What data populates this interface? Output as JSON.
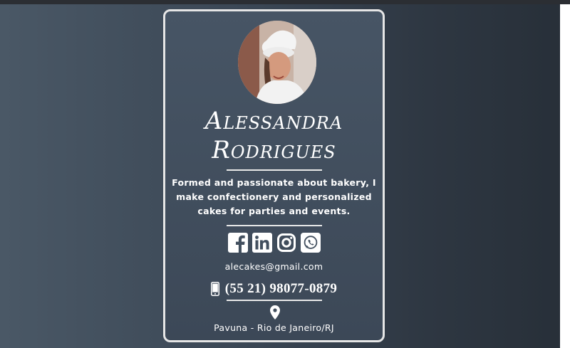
{
  "profile": {
    "name_line1": "Alessandra",
    "name_line2": "Rodrigues",
    "bio": "Formed and passionate about bakery, I make confectionery and personalized cakes for parties and events.",
    "email": "alecakes@gmail.com",
    "phone": "(55 21) 98077-0879",
    "location": "Pavuna - Rio de Janeiro/RJ"
  },
  "social": [
    {
      "name": "facebook-icon"
    },
    {
      "name": "linkedin-icon"
    },
    {
      "name": "instagram-icon"
    },
    {
      "name": "whatsapp-icon"
    }
  ],
  "colors": {
    "background_left": "#4a5866",
    "background_right": "#272f38",
    "card": "#424f5e",
    "card_border": "#e6e6e6",
    "text": "#ffffff"
  }
}
